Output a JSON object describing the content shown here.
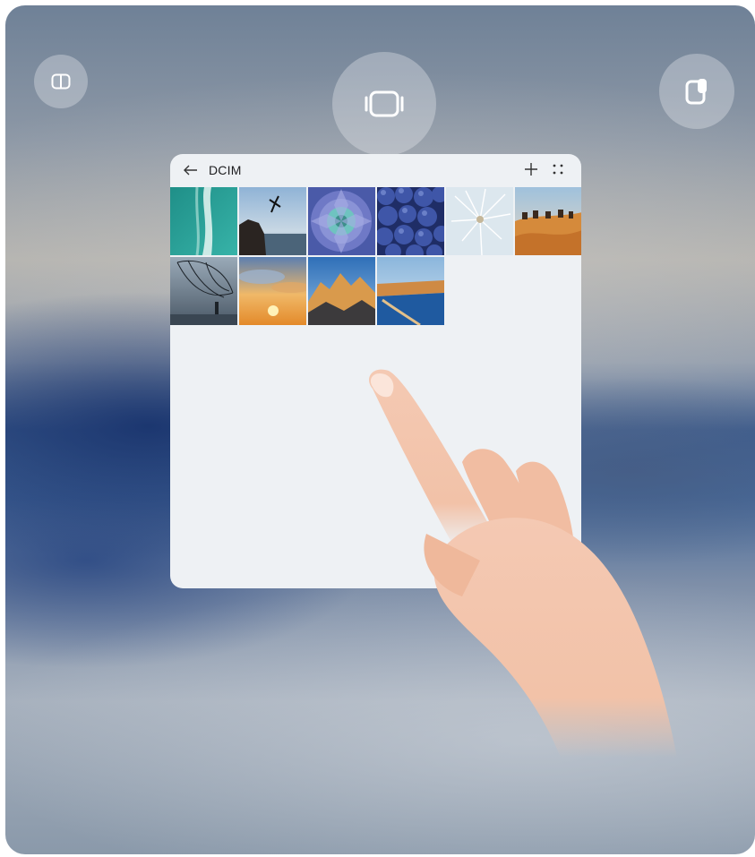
{
  "controls": {
    "split_icon": "split-screen-icon",
    "floating_icon": "floating-window-icon",
    "side_icon": "side-window-icon"
  },
  "window": {
    "title": "DCIM",
    "back_icon": "back-arrow-icon",
    "add_icon": "plus-icon",
    "more_icon": "more-dots-icon"
  },
  "gallery": {
    "photos": [
      "aerial-sea",
      "cliff-jumper",
      "succulent",
      "blueberries",
      "dandelion",
      "desert-camels",
      "fishing-net",
      "sunset-clouds",
      "mountain-range",
      "lake-shore"
    ]
  },
  "colors": {
    "window_bg": "#eef1f4",
    "control_bg": "rgba(225,228,234,0.38)",
    "skin": "#f4c9b3"
  }
}
